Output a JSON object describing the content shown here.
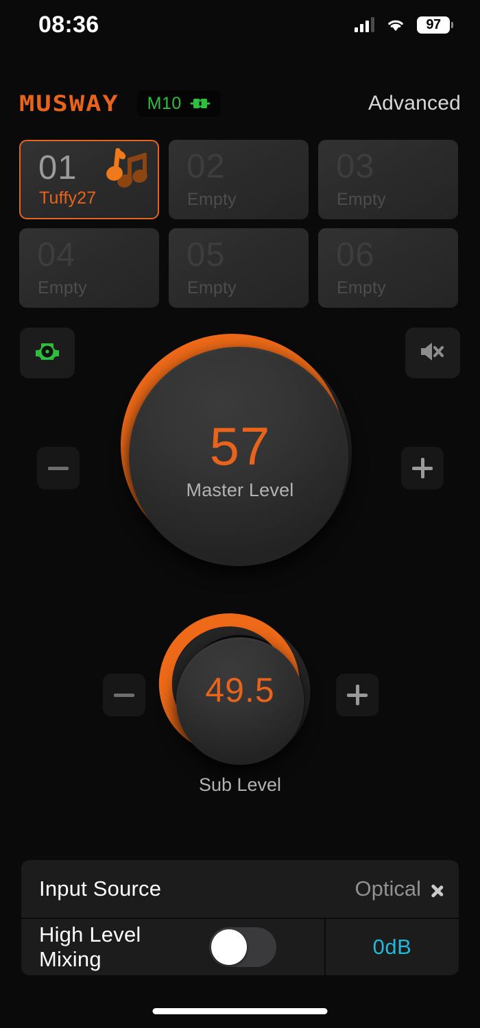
{
  "status_bar": {
    "time": "08:36",
    "battery_percent": "97",
    "cellular_icon": "cellular-signal-icon",
    "wifi_icon": "wifi-icon",
    "battery_icon": "battery-icon"
  },
  "header": {
    "brand": "MUSWAY",
    "device_model": "M10",
    "device_connection_icon": "plug-connected-icon",
    "advanced_label": "Advanced"
  },
  "presets": {
    "items": [
      {
        "number": "01",
        "name": "Tuffy27",
        "active": true,
        "icon": "music-note-icon"
      },
      {
        "number": "02",
        "name": "Empty",
        "active": false,
        "icon": ""
      },
      {
        "number": "03",
        "name": "Empty",
        "active": false,
        "icon": ""
      },
      {
        "number": "04",
        "name": "Empty",
        "active": false,
        "icon": ""
      },
      {
        "number": "05",
        "name": "Empty",
        "active": false,
        "icon": ""
      },
      {
        "number": "06",
        "name": "Empty",
        "active": false,
        "icon": ""
      }
    ]
  },
  "master": {
    "value": "57",
    "label": "Master Level",
    "min": 0,
    "max": 100,
    "percent": 57,
    "speaker_icon": "speaker-setup-icon",
    "mute_icon": "speaker-mute-icon",
    "decrease_label": "−",
    "increase_label": "+"
  },
  "sub": {
    "value": "49.5",
    "label": "Sub Level",
    "min": 0,
    "max": 100,
    "percent": 49.5,
    "decrease_label": "−",
    "increase_label": "+"
  },
  "settings": {
    "input_source": {
      "label": "Input Source",
      "value": "Optical",
      "chevron_icon": "chevron-right-icon"
    },
    "high_level_mixing": {
      "label": "High Level Mixing",
      "toggle_on": false,
      "gain": "0dB"
    }
  },
  "colors": {
    "accent_orange": "#e8641c",
    "device_green": "#2fbd3e",
    "gain_teal": "#22b8d8",
    "background": "#0a0a0a",
    "card": "#1c1c1c"
  }
}
